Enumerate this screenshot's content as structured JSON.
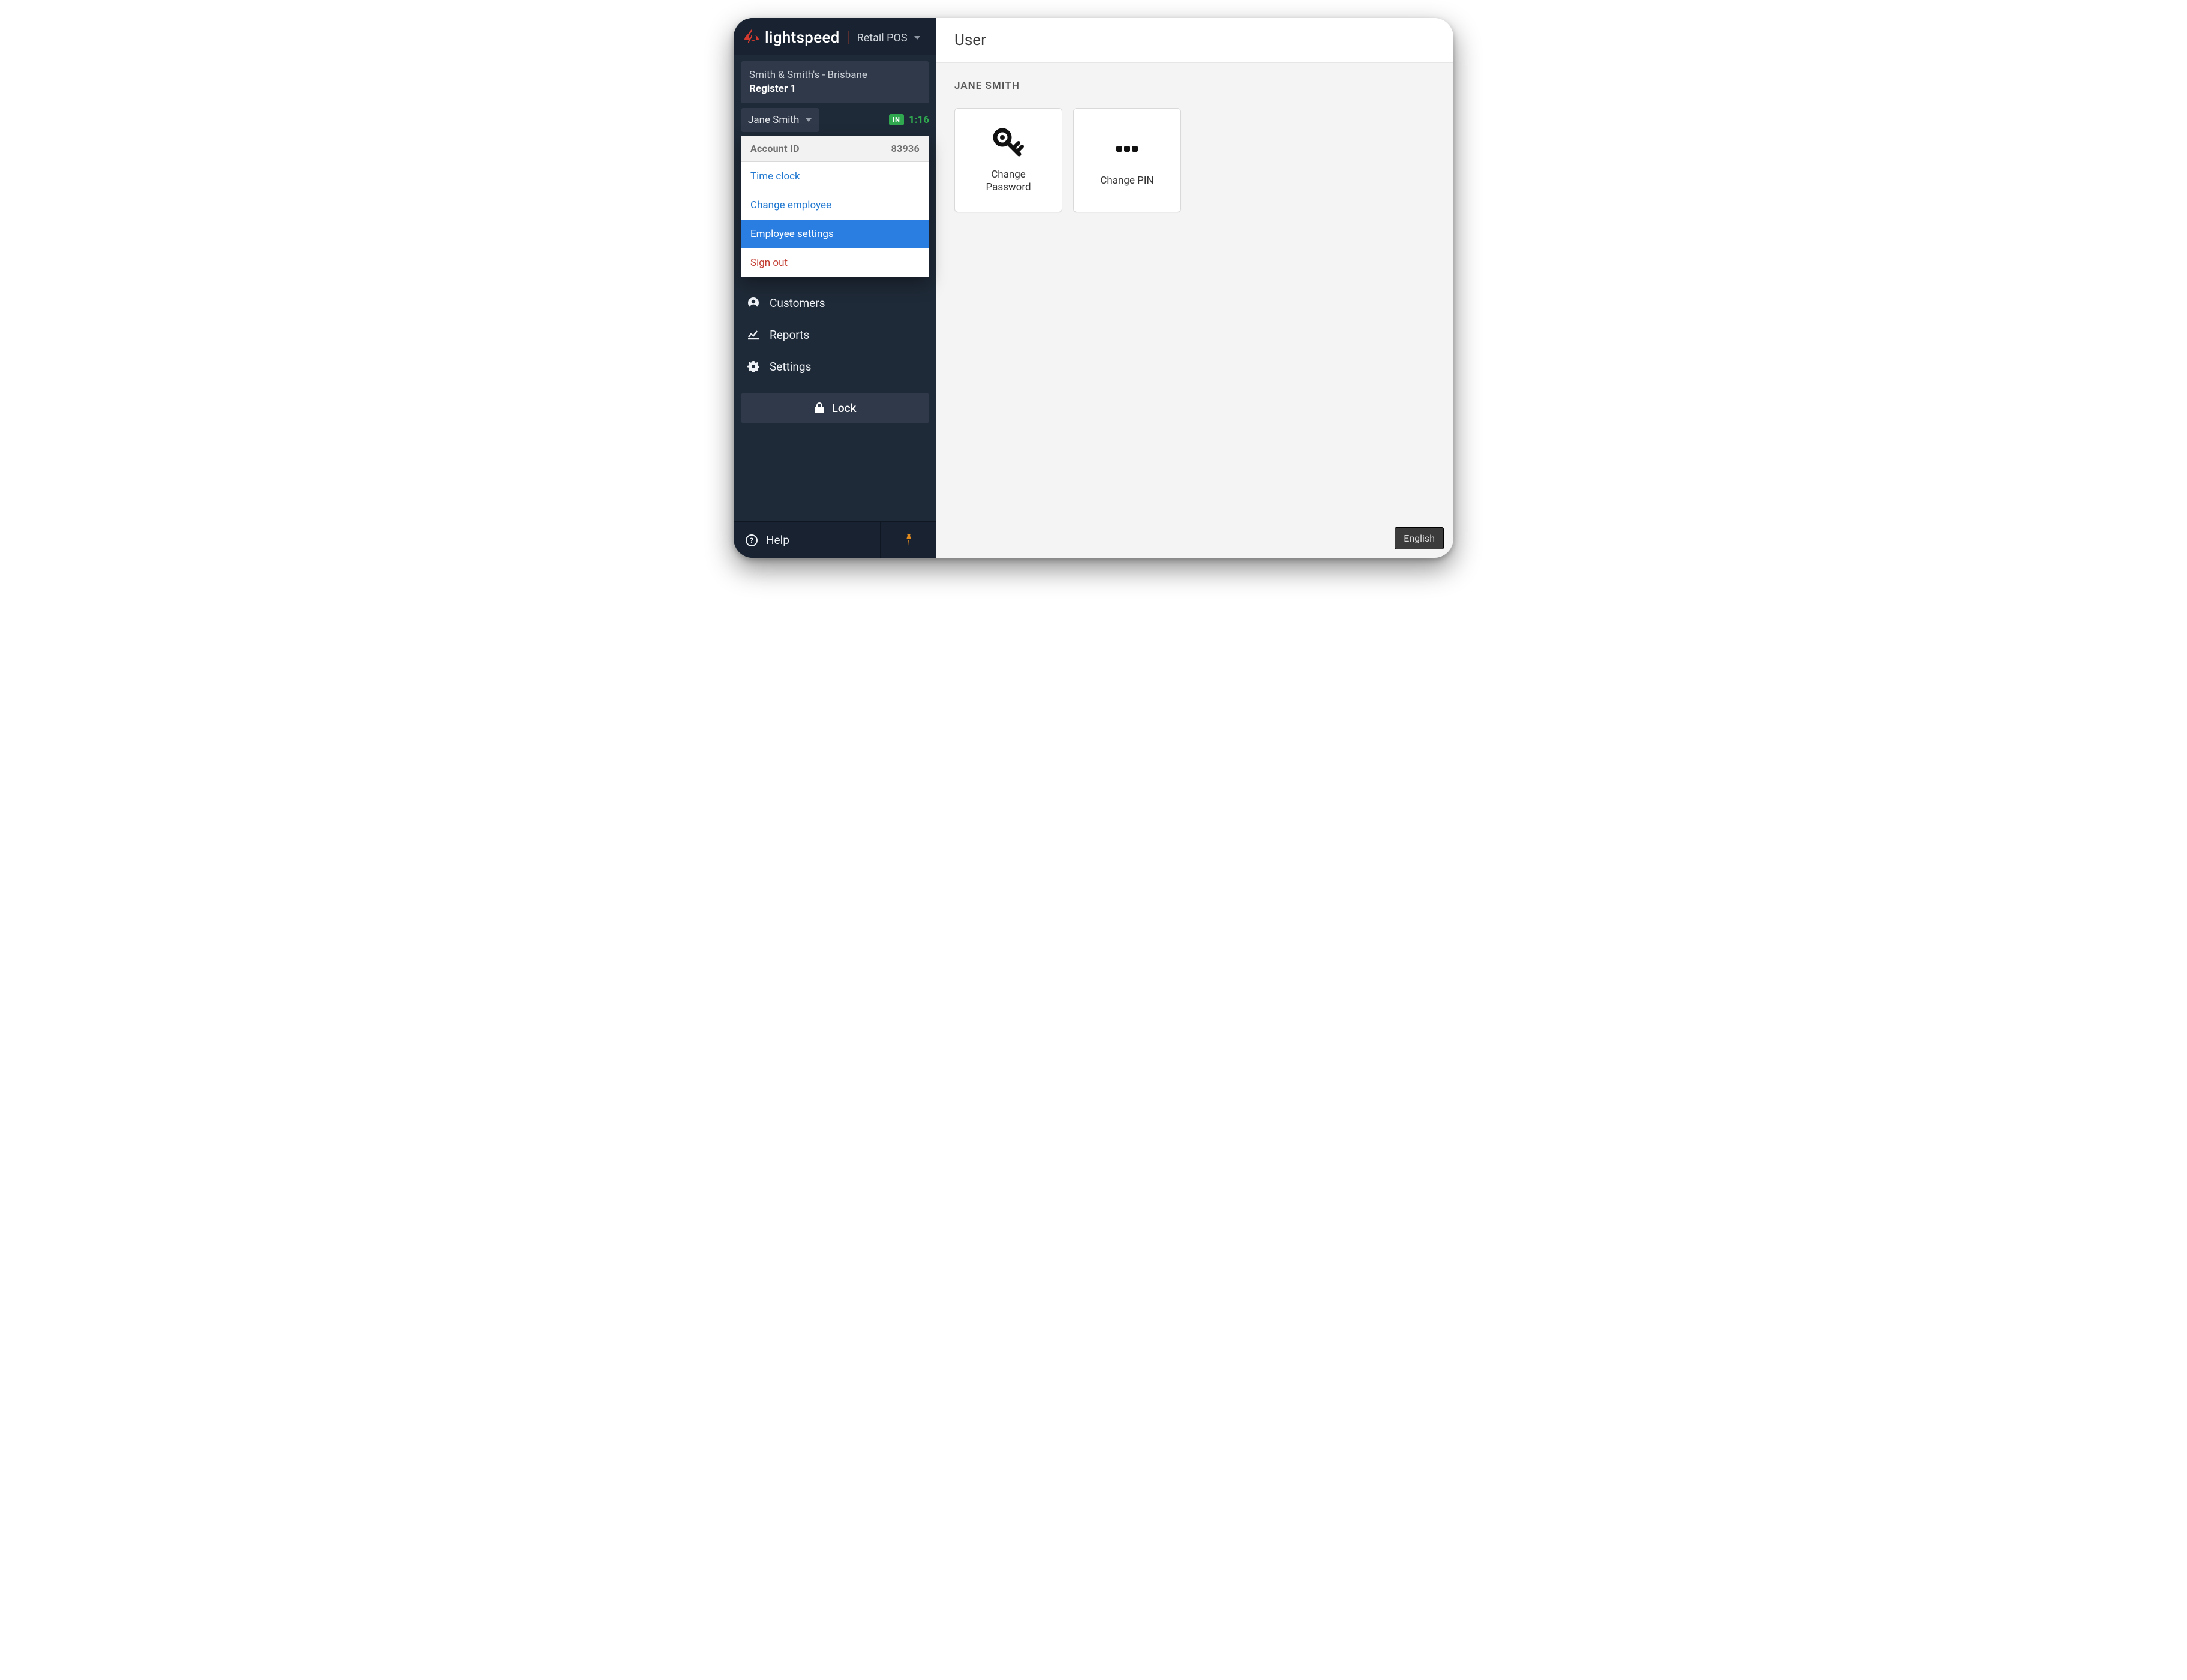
{
  "brand": {
    "name": "lightspeed",
    "product": "Retail POS"
  },
  "context": {
    "location": "Smith & Smith's - Brisbane",
    "register": "Register 1"
  },
  "user": {
    "name": "Jane Smith",
    "status_badge": "IN",
    "status_time": "1:16"
  },
  "dropdown": {
    "account_id_label": "Account ID",
    "account_id_value": "83936",
    "items": [
      {
        "label": "Time clock",
        "kind": "link"
      },
      {
        "label": "Change employee",
        "kind": "link"
      },
      {
        "label": "Employee settings",
        "kind": "selected"
      },
      {
        "label": "Sign out",
        "kind": "danger"
      }
    ]
  },
  "nav": [
    {
      "label": "Customers",
      "icon": "user-circle-icon"
    },
    {
      "label": "Reports",
      "icon": "chart-line-icon"
    },
    {
      "label": "Settings",
      "icon": "gear-icon"
    }
  ],
  "lock_label": "Lock",
  "footer": {
    "help": "Help"
  },
  "main": {
    "title": "User",
    "section_title": "JANE SMITH",
    "tiles": [
      {
        "label": "Change\nPassword",
        "icon": "key-icon"
      },
      {
        "label": "Change PIN",
        "icon": "pin-dots-icon"
      }
    ]
  },
  "language": "English"
}
